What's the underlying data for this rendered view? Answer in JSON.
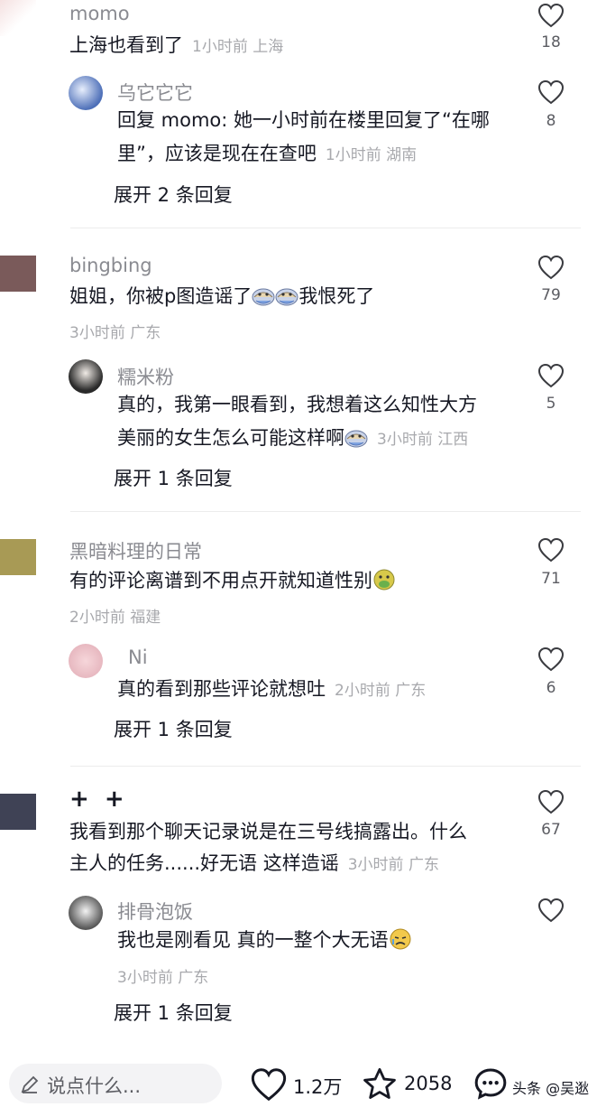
{
  "comments": [
    {
      "user": "momo",
      "text": "上海也看到了",
      "meta": "1小时前 上海",
      "likes": "18",
      "reply": {
        "user": "乌它它它",
        "line1": "回复 momo: 她一小时前在楼里回复了“在哪",
        "line2": "里”，应该是现在在查吧",
        "meta": "1小时前 湖南",
        "likes": "8"
      },
      "expand": "展开 2 条回复"
    },
    {
      "user": "bingbing",
      "text_before": "姐姐，你被p图造谣了",
      "text_after": "我恨死了",
      "meta": "3小时前 广东",
      "likes": "79",
      "reply": {
        "user": "糯米粉",
        "line1": "真的，我第一眼看到，我想着这么知性大方",
        "line2": "美丽的女生怎么可能这样啊",
        "meta": "3小时前 江西",
        "likes": "5"
      },
      "expand": "展开 1 条回复"
    },
    {
      "user": "黑暗料理的日常",
      "text": "有的评论离谱到不用点开就知道性别",
      "meta": "2小时前 福建",
      "likes": "71",
      "reply": {
        "user": "Ni",
        "line1": "真的看到那些评论就想吐",
        "meta": "2小时前 广东",
        "likes": "6"
      },
      "expand": "展开 1 条回复"
    },
    {
      "user": "+ +",
      "line1": "我看到那个聊天记录说是在三号线搞露出。什么",
      "line2": "主人的任务......好无语 这样造谣",
      "meta": "3小时前 广东",
      "likes": "67",
      "reply": {
        "user": "排骨泡饭",
        "line1": "我也是刚看见 真的一整个大无语",
        "meta": "3小时前 广东",
        "likes": ""
      },
      "expand": "展开 1 条回复"
    }
  ],
  "bottom_bar": {
    "input_placeholder": "说点什么...",
    "likes": "1.2万",
    "favorites": "2058",
    "watermark": "头条 @吴逖"
  },
  "icons": {
    "like": "heart-outline-icon",
    "favorite": "star-outline-icon",
    "comment": "chat-bubble-icon",
    "edit": "pencil-icon"
  },
  "colors": {
    "text": "#161823",
    "secondary": "#8a8b91",
    "meta": "#a8a9ad"
  }
}
